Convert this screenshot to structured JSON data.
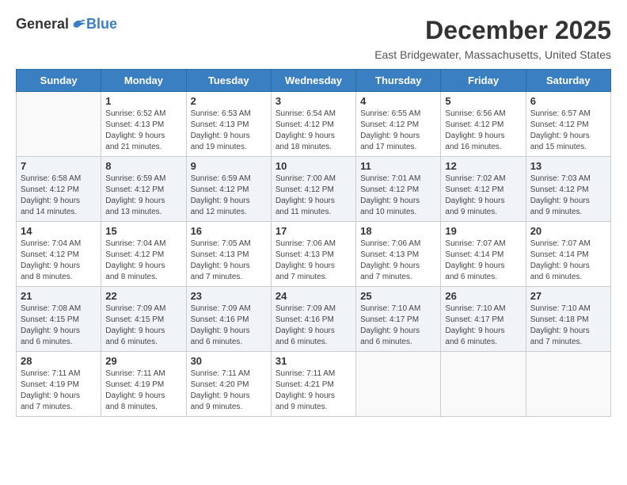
{
  "logo": {
    "general": "General",
    "blue": "Blue"
  },
  "title": "December 2025",
  "location": "East Bridgewater, Massachusetts, United States",
  "days_of_week": [
    "Sunday",
    "Monday",
    "Tuesday",
    "Wednesday",
    "Thursday",
    "Friday",
    "Saturday"
  ],
  "weeks": [
    [
      {
        "day": "",
        "info": ""
      },
      {
        "day": "1",
        "info": "Sunrise: 6:52 AM\nSunset: 4:13 PM\nDaylight: 9 hours\nand 21 minutes."
      },
      {
        "day": "2",
        "info": "Sunrise: 6:53 AM\nSunset: 4:13 PM\nDaylight: 9 hours\nand 19 minutes."
      },
      {
        "day": "3",
        "info": "Sunrise: 6:54 AM\nSunset: 4:12 PM\nDaylight: 9 hours\nand 18 minutes."
      },
      {
        "day": "4",
        "info": "Sunrise: 6:55 AM\nSunset: 4:12 PM\nDaylight: 9 hours\nand 17 minutes."
      },
      {
        "day": "5",
        "info": "Sunrise: 6:56 AM\nSunset: 4:12 PM\nDaylight: 9 hours\nand 16 minutes."
      },
      {
        "day": "6",
        "info": "Sunrise: 6:57 AM\nSunset: 4:12 PM\nDaylight: 9 hours\nand 15 minutes."
      }
    ],
    [
      {
        "day": "7",
        "info": "Sunrise: 6:58 AM\nSunset: 4:12 PM\nDaylight: 9 hours\nand 14 minutes."
      },
      {
        "day": "8",
        "info": "Sunrise: 6:59 AM\nSunset: 4:12 PM\nDaylight: 9 hours\nand 13 minutes."
      },
      {
        "day": "9",
        "info": "Sunrise: 6:59 AM\nSunset: 4:12 PM\nDaylight: 9 hours\nand 12 minutes."
      },
      {
        "day": "10",
        "info": "Sunrise: 7:00 AM\nSunset: 4:12 PM\nDaylight: 9 hours\nand 11 minutes."
      },
      {
        "day": "11",
        "info": "Sunrise: 7:01 AM\nSunset: 4:12 PM\nDaylight: 9 hours\nand 10 minutes."
      },
      {
        "day": "12",
        "info": "Sunrise: 7:02 AM\nSunset: 4:12 PM\nDaylight: 9 hours\nand 9 minutes."
      },
      {
        "day": "13",
        "info": "Sunrise: 7:03 AM\nSunset: 4:12 PM\nDaylight: 9 hours\nand 9 minutes."
      }
    ],
    [
      {
        "day": "14",
        "info": "Sunrise: 7:04 AM\nSunset: 4:12 PM\nDaylight: 9 hours\nand 8 minutes."
      },
      {
        "day": "15",
        "info": "Sunrise: 7:04 AM\nSunset: 4:12 PM\nDaylight: 9 hours\nand 8 minutes."
      },
      {
        "day": "16",
        "info": "Sunrise: 7:05 AM\nSunset: 4:13 PM\nDaylight: 9 hours\nand 7 minutes."
      },
      {
        "day": "17",
        "info": "Sunrise: 7:06 AM\nSunset: 4:13 PM\nDaylight: 9 hours\nand 7 minutes."
      },
      {
        "day": "18",
        "info": "Sunrise: 7:06 AM\nSunset: 4:13 PM\nDaylight: 9 hours\nand 7 minutes."
      },
      {
        "day": "19",
        "info": "Sunrise: 7:07 AM\nSunset: 4:14 PM\nDaylight: 9 hours\nand 6 minutes."
      },
      {
        "day": "20",
        "info": "Sunrise: 7:07 AM\nSunset: 4:14 PM\nDaylight: 9 hours\nand 6 minutes."
      }
    ],
    [
      {
        "day": "21",
        "info": "Sunrise: 7:08 AM\nSunset: 4:15 PM\nDaylight: 9 hours\nand 6 minutes."
      },
      {
        "day": "22",
        "info": "Sunrise: 7:09 AM\nSunset: 4:15 PM\nDaylight: 9 hours\nand 6 minutes."
      },
      {
        "day": "23",
        "info": "Sunrise: 7:09 AM\nSunset: 4:16 PM\nDaylight: 9 hours\nand 6 minutes."
      },
      {
        "day": "24",
        "info": "Sunrise: 7:09 AM\nSunset: 4:16 PM\nDaylight: 9 hours\nand 6 minutes."
      },
      {
        "day": "25",
        "info": "Sunrise: 7:10 AM\nSunset: 4:17 PM\nDaylight: 9 hours\nand 6 minutes."
      },
      {
        "day": "26",
        "info": "Sunrise: 7:10 AM\nSunset: 4:17 PM\nDaylight: 9 hours\nand 6 minutes."
      },
      {
        "day": "27",
        "info": "Sunrise: 7:10 AM\nSunset: 4:18 PM\nDaylight: 9 hours\nand 7 minutes."
      }
    ],
    [
      {
        "day": "28",
        "info": "Sunrise: 7:11 AM\nSunset: 4:19 PM\nDaylight: 9 hours\nand 7 minutes."
      },
      {
        "day": "29",
        "info": "Sunrise: 7:11 AM\nSunset: 4:19 PM\nDaylight: 9 hours\nand 8 minutes."
      },
      {
        "day": "30",
        "info": "Sunrise: 7:11 AM\nSunset: 4:20 PM\nDaylight: 9 hours\nand 9 minutes."
      },
      {
        "day": "31",
        "info": "Sunrise: 7:11 AM\nSunset: 4:21 PM\nDaylight: 9 hours\nand 9 minutes."
      },
      {
        "day": "",
        "info": ""
      },
      {
        "day": "",
        "info": ""
      },
      {
        "day": "",
        "info": ""
      }
    ]
  ]
}
